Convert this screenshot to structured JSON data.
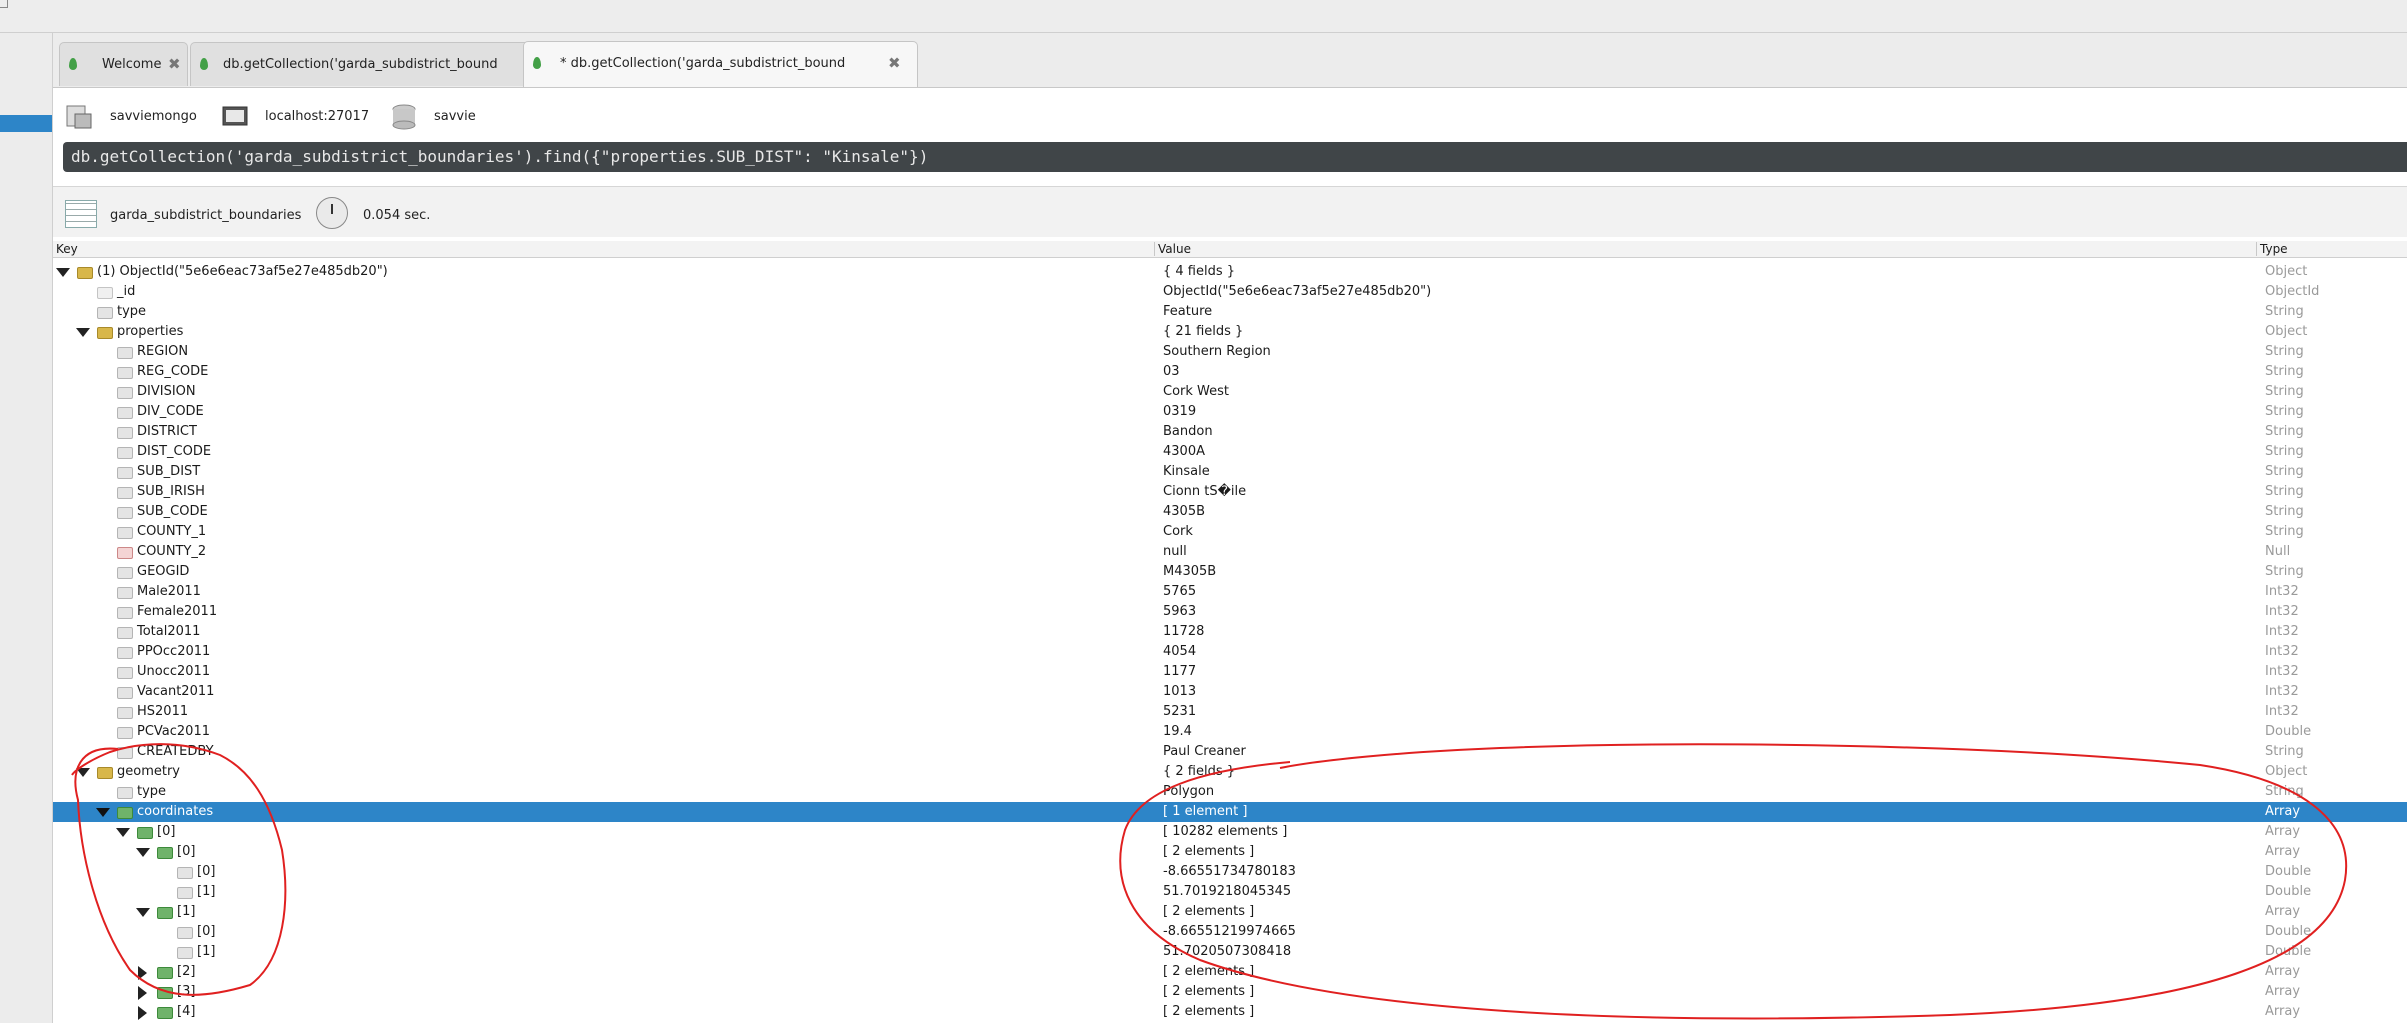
{
  "tabs": [
    {
      "label": "Welcome"
    },
    {
      "label": "db.getCollection('garda_subdistrict_bound"
    },
    {
      "label": "* db.getCollection('garda_subdistrict_bound"
    }
  ],
  "connection": {
    "server": "savviemongo",
    "host": "localhost:27017",
    "database": "savvie"
  },
  "query": {
    "text": "db.getCollection('garda_subdistrict_boundaries').find({\"properties.SUB_DIST\": \"Kinsale\"})"
  },
  "result": {
    "collection": "garda_subdistrict_boundaries",
    "time": "0.054 sec."
  },
  "columns": {
    "key": "Key",
    "value": "Value",
    "type": "Type"
  },
  "rows": [
    {
      "key": "(1) ObjectId(\"5e6e6eac73af5e27e485db20\")",
      "value": "{ 4 fields }",
      "type": "Object",
      "icon": "obj",
      "depth": 0,
      "toggle": "open"
    },
    {
      "key": "_id",
      "value": "ObjectId(\"5e6e6eac73af5e27e485db20\")",
      "type": "ObjectId",
      "icon": "oid",
      "depth": 1
    },
    {
      "key": "type",
      "value": "Feature",
      "type": "String",
      "icon": "str",
      "depth": 1
    },
    {
      "key": "properties",
      "value": "{ 21 fields }",
      "type": "Object",
      "icon": "obj",
      "depth": 1,
      "toggle": "open"
    },
    {
      "key": "REGION",
      "value": "Southern Region",
      "type": "String",
      "icon": "str",
      "depth": 2
    },
    {
      "key": "REG_CODE",
      "value": "03",
      "type": "String",
      "icon": "str",
      "depth": 2
    },
    {
      "key": "DIVISION",
      "value": "Cork West",
      "type": "String",
      "icon": "str",
      "depth": 2
    },
    {
      "key": "DIV_CODE",
      "value": "0319",
      "type": "String",
      "icon": "str",
      "depth": 2
    },
    {
      "key": "DISTRICT",
      "value": "Bandon",
      "type": "String",
      "icon": "str",
      "depth": 2
    },
    {
      "key": "DIST_CODE",
      "value": "4300A",
      "type": "String",
      "icon": "str",
      "depth": 2
    },
    {
      "key": "SUB_DIST",
      "value": "Kinsale",
      "type": "String",
      "icon": "str",
      "depth": 2
    },
    {
      "key": "SUB_IRISH",
      "value": "Cionn tS�ile",
      "type": "String",
      "icon": "str",
      "depth": 2
    },
    {
      "key": "SUB_CODE",
      "value": "4305B",
      "type": "String",
      "icon": "str",
      "depth": 2
    },
    {
      "key": "COUNTY_1",
      "value": "Cork",
      "type": "String",
      "icon": "str",
      "depth": 2
    },
    {
      "key": "COUNTY_2",
      "value": "null",
      "type": "Null",
      "icon": "null",
      "depth": 2
    },
    {
      "key": "GEOGID",
      "value": "M4305B",
      "type": "String",
      "icon": "str",
      "depth": 2
    },
    {
      "key": "Male2011",
      "value": "5765",
      "type": "Int32",
      "icon": "num",
      "depth": 2
    },
    {
      "key": "Female2011",
      "value": "5963",
      "type": "Int32",
      "icon": "num",
      "depth": 2
    },
    {
      "key": "Total2011",
      "value": "11728",
      "type": "Int32",
      "icon": "num",
      "depth": 2
    },
    {
      "key": "PPOcc2011",
      "value": "4054",
      "type": "Int32",
      "icon": "num",
      "depth": 2
    },
    {
      "key": "Unocc2011",
      "value": "1177",
      "type": "Int32",
      "icon": "num",
      "depth": 2
    },
    {
      "key": "Vacant2011",
      "value": "1013",
      "type": "Int32",
      "icon": "num",
      "depth": 2
    },
    {
      "key": "HS2011",
      "value": "5231",
      "type": "Int32",
      "icon": "num",
      "depth": 2
    },
    {
      "key": "PCVac2011",
      "value": "19.4",
      "type": "Double",
      "icon": "num",
      "depth": 2
    },
    {
      "key": "CREATEDBY",
      "value": "Paul Creaner",
      "type": "String",
      "icon": "str",
      "depth": 2
    },
    {
      "key": "geometry",
      "value": "{ 2 fields }",
      "type": "Object",
      "icon": "obj",
      "depth": 1,
      "toggle": "open"
    },
    {
      "key": "type",
      "value": "Polygon",
      "type": "String",
      "icon": "str",
      "depth": 2
    },
    {
      "key": "coordinates",
      "value": "[ 1 element ]",
      "type": "Array",
      "icon": "arr",
      "depth": 2,
      "toggle": "open",
      "selected": true
    },
    {
      "key": "[0]",
      "value": "[ 10282 elements ]",
      "type": "Array",
      "icon": "arr",
      "depth": 3,
      "toggle": "open"
    },
    {
      "key": "[0]",
      "value": "[ 2 elements ]",
      "type": "Array",
      "icon": "arr",
      "depth": 4,
      "toggle": "open"
    },
    {
      "key": "[0]",
      "value": "-8.66551734780183",
      "type": "Double",
      "icon": "num",
      "depth": 5
    },
    {
      "key": "[1]",
      "value": "51.7019218045345",
      "type": "Double",
      "icon": "num",
      "depth": 5
    },
    {
      "key": "[1]",
      "value": "[ 2 elements ]",
      "type": "Array",
      "icon": "arr",
      "depth": 4,
      "toggle": "open"
    },
    {
      "key": "[0]",
      "value": "-8.66551219974665",
      "type": "Double",
      "icon": "num",
      "depth": 5
    },
    {
      "key": "[1]",
      "value": "51.7020507308418",
      "type": "Double",
      "icon": "num",
      "depth": 5
    },
    {
      "key": "[2]",
      "value": "[ 2 elements ]",
      "type": "Array",
      "icon": "arr",
      "depth": 4,
      "toggle": "closed"
    },
    {
      "key": "[3]",
      "value": "[ 2 elements ]",
      "type": "Array",
      "icon": "arr",
      "depth": 4,
      "toggle": "closed"
    },
    {
      "key": "[4]",
      "value": "[ 2 elements ]",
      "type": "Array",
      "icon": "arr",
      "depth": 4,
      "toggle": "closed"
    }
  ],
  "annotation_color": "#e02020"
}
